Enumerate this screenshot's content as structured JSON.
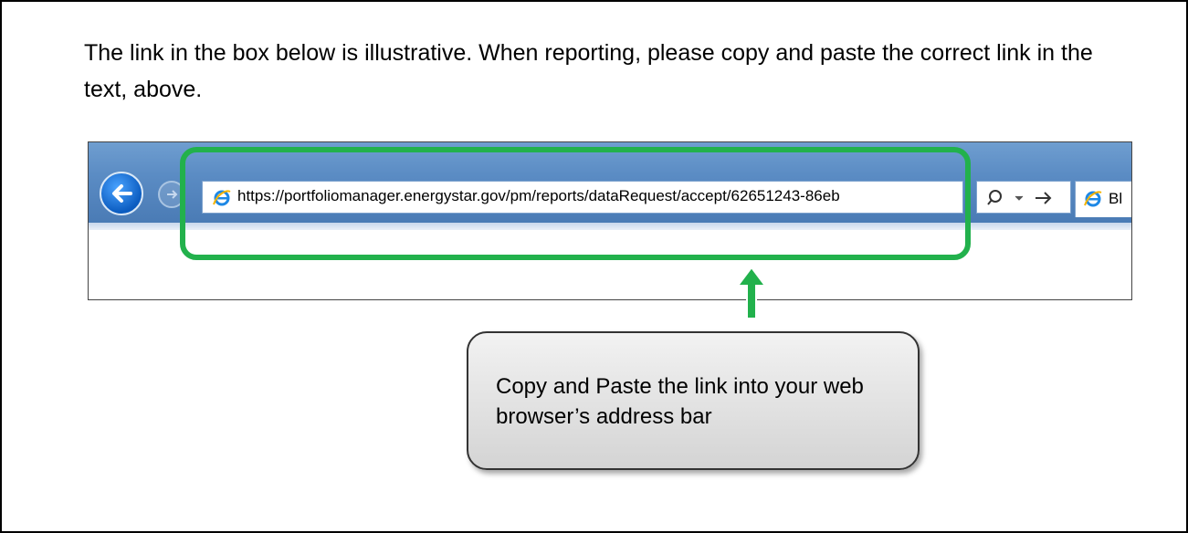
{
  "intro_text": "The link in the box below is illustrative. When reporting, please copy and paste the correct link in the text, above.",
  "browser": {
    "url": "https://portfoliomanager.energystar.gov/pm/reports/dataRequest/accept/62651243-86eb",
    "tab_label": "Bl",
    "icons": {
      "back": "back-arrow-icon",
      "forward": "forward-arrow-icon",
      "site": "internet-explorer-icon",
      "search": "search-icon",
      "dropdown": "dropdown-icon",
      "go": "go-arrow-icon"
    }
  },
  "callout_text": "Copy and Paste the link into your web browser’s address bar",
  "colors": {
    "highlight": "#22b14c",
    "arrow": "#22b14c",
    "chrome_blue": "#5b8cc4"
  }
}
